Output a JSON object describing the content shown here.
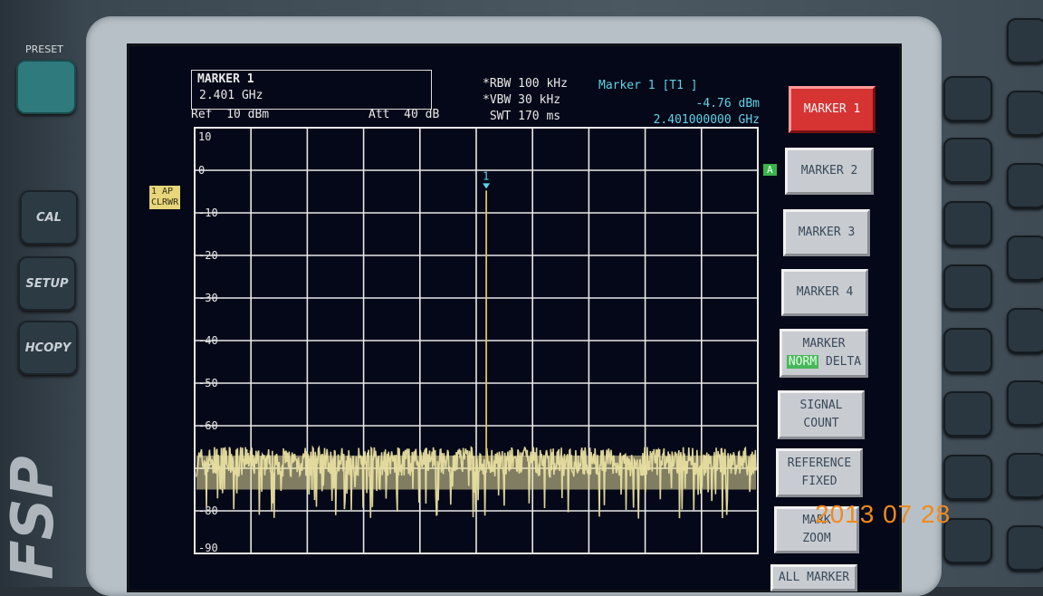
{
  "device": {
    "preset_label": "PRESET",
    "side_buttons": [
      {
        "label": "CAL"
      },
      {
        "label": "SETUP"
      },
      {
        "label": "HCOPY"
      }
    ],
    "brand": "FSP"
  },
  "header": {
    "marker_box_title": "MARKER 1",
    "marker_box_value": "2.401 GHz",
    "ref": "Ref  10 dBm",
    "att": "Att  40 dB",
    "rbw": "*RBW 100 kHz",
    "vbw": "*VBW 30 kHz",
    "swt": " SWT 170 ms",
    "marker_readout_title": "Marker 1 [T1 ]",
    "marker_level": "-4.76 dBm",
    "marker_freq": "2.401000000 GHz"
  },
  "trace_badge": {
    "line1": "1 AP",
    "line2": "CLRWR"
  },
  "trace_indicator": "A",
  "softkeys": [
    {
      "line1": "MARKER 1",
      "active": true
    },
    {
      "line1": "MARKER 2"
    },
    {
      "line1": "MARKER 3"
    },
    {
      "line1": "MARKER 4"
    },
    {
      "line1": "MARKER",
      "norm": "NORM",
      "delta": "DELTA"
    },
    {
      "line1": "SIGNAL",
      "line2": "COUNT"
    },
    {
      "line1": "REFERENCE",
      "line2": "FIXED"
    },
    {
      "line1": "MARK",
      "line2": "ZOOM"
    },
    {
      "line1": "ALL MARKER"
    }
  ],
  "photo_date": "2013 07 28",
  "colors": {
    "trace": "#e8dfa0",
    "grid": "#e8e8e8",
    "readout": "#5fd3e8",
    "active_key": "#d63333"
  },
  "chart_data": {
    "type": "line",
    "ylabel": "dBm",
    "y_ticks": [
      "10",
      "0",
      "-10",
      "-20",
      "-30",
      "-40",
      "-50",
      "-60",
      "-70",
      "-80",
      "-90"
    ],
    "ylim": [
      -90,
      10
    ],
    "grid": true,
    "x_divisions": 10,
    "series": [
      {
        "noise_floor_dBm": -68,
        "noise_min_dBm": -82,
        "noise_max_dBm": -65
      }
    ],
    "peak": {
      "x_division": 5.5,
      "level_dBm": -4.76,
      "marker_label": "1"
    }
  }
}
